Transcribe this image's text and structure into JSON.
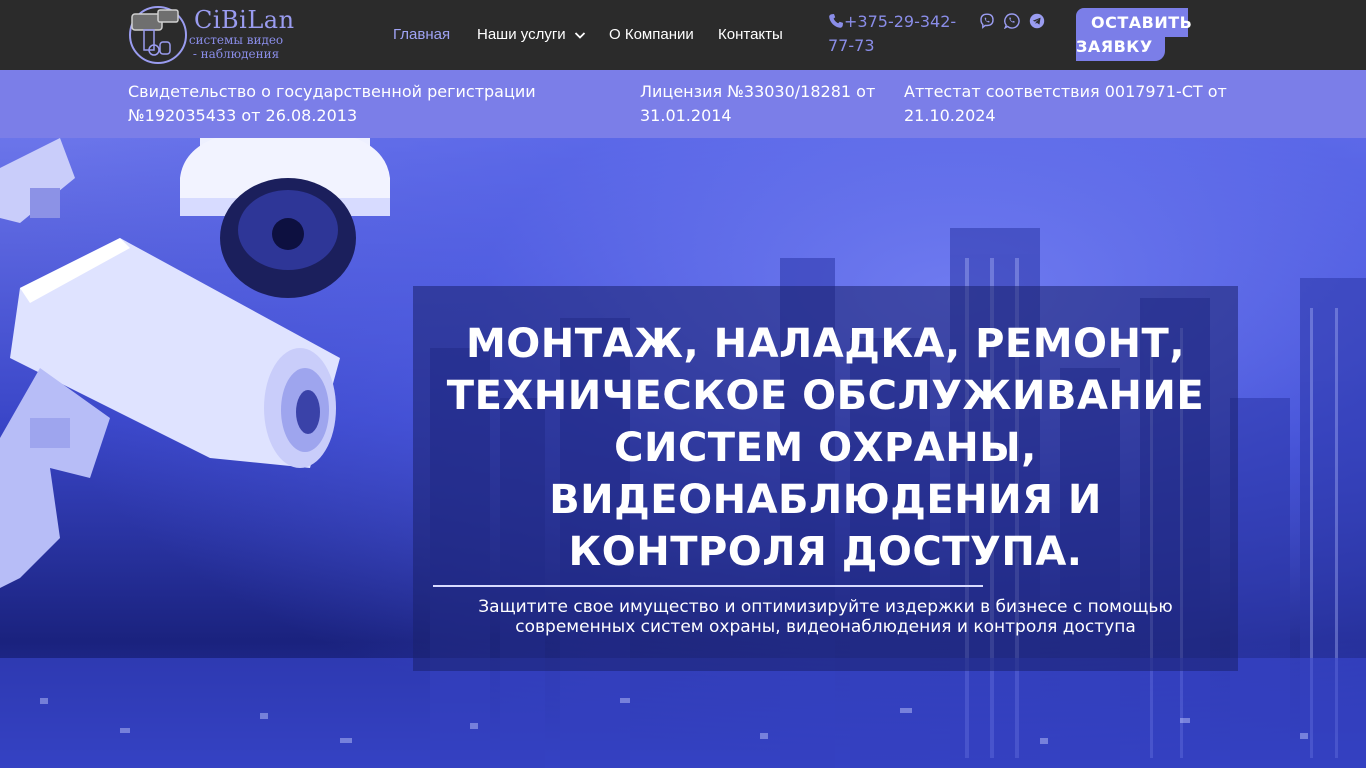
{
  "brand": {
    "name": "CiBiLan",
    "tagline": "системы видео - наблюдения"
  },
  "nav": {
    "home": "Главная",
    "services": "Наши услуги",
    "about": "О Компании",
    "contacts": "Контакты"
  },
  "contact": {
    "phone": "+375-29-342-77-73"
  },
  "socials": [
    "viber-icon",
    "whatsapp-icon",
    "telegram-icon"
  ],
  "cta": {
    "line1": "ОСТАВИТЬ",
    "line2": "ЗАЯВКУ"
  },
  "licenses": {
    "registration": "Свидетельство о государственной регистрации №192035433 от 26.08.2013",
    "license": "Лицензия №33030/18281 от 31.01.2014",
    "attestation": "Аттестат соответствия 0017971-СТ от 21.10.2024"
  },
  "hero": {
    "title": "МОНТАЖ, НАЛАДКА, РЕМОНТ, ТЕХНИЧЕСКОЕ ОБСЛУЖИВАНИЕ СИСТЕМ ОХРАНЫ, ВИДЕОНАБЛЮДЕНИЯ И КОНТРОЛЯ ДОСТУПА.",
    "subtitle": "Защитите свое имущество и оптимизируйте издержки в бизнесе с помощью современных систем охраны, видеонаблюдения и контроля доступа"
  },
  "colors": {
    "header_bg": "#2b2b2b",
    "accent": "#7b7ee8",
    "nav_active": "#a0a3f4"
  }
}
